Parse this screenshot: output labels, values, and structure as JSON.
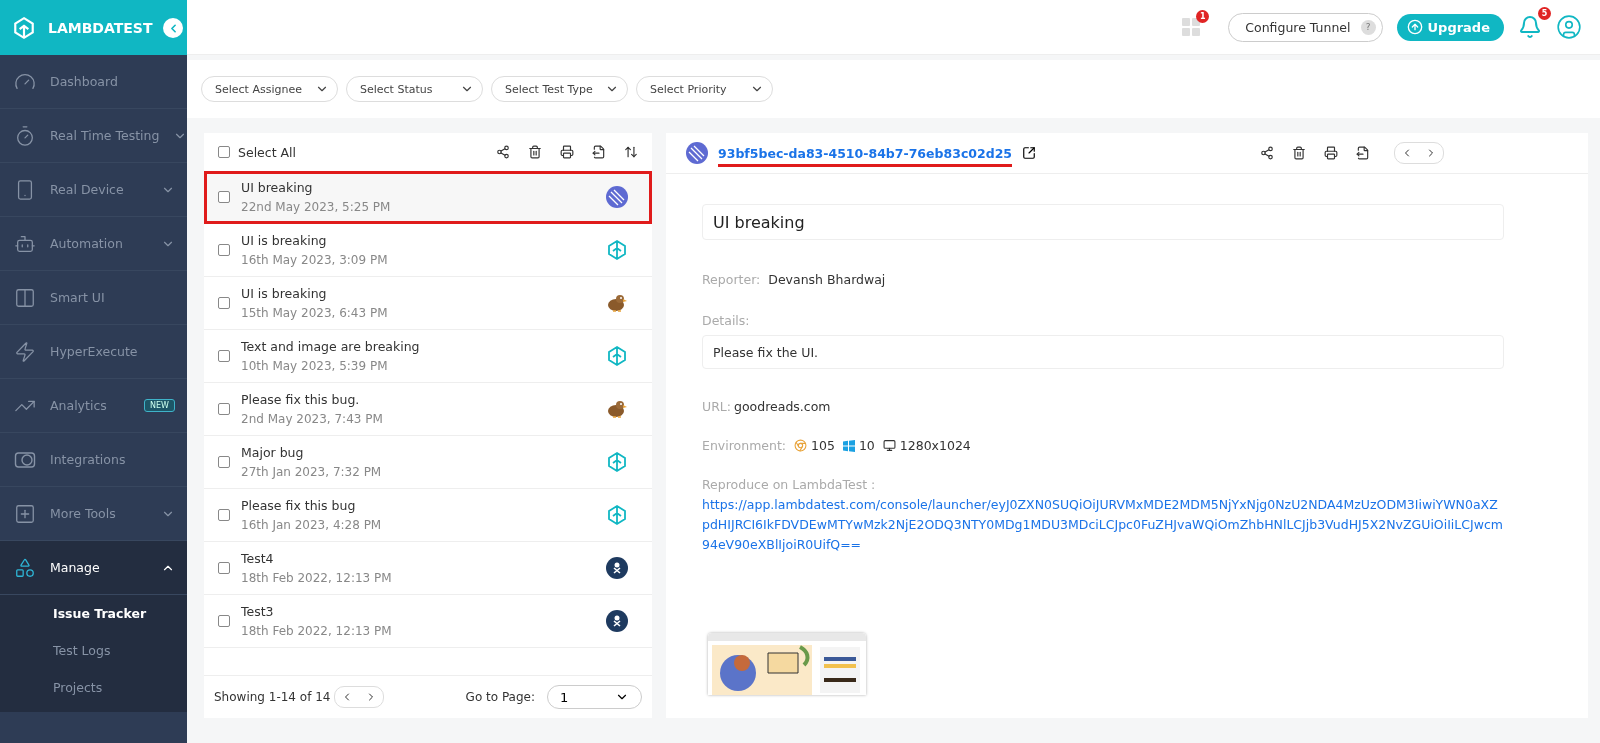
{
  "header": {
    "brand": "LAMBDATEST",
    "apps_badge": "1",
    "configure_tunnel": "Configure Tunnel",
    "help": "?",
    "upgrade": "Upgrade",
    "notifications_badge": "5"
  },
  "sidebar": {
    "items": [
      {
        "label": "Dashboard",
        "kind": "gauge"
      },
      {
        "label": "Real Time Testing",
        "kind": "timer",
        "expanded": false
      },
      {
        "label": "Real Device",
        "kind": "device",
        "expanded": false
      },
      {
        "label": "Automation",
        "kind": "robot",
        "expanded": false
      },
      {
        "label": "Smart UI",
        "kind": "split"
      },
      {
        "label": "HyperExecute",
        "kind": "bolt"
      },
      {
        "label": "Analytics",
        "kind": "chart",
        "badge": "NEW"
      },
      {
        "label": "Integrations",
        "kind": "integrations"
      },
      {
        "label": "More Tools",
        "kind": "plus",
        "expanded": false
      },
      {
        "label": "Manage",
        "kind": "shapes",
        "expanded": true,
        "children": [
          {
            "label": "Issue Tracker",
            "selected": true
          },
          {
            "label": "Test Logs",
            "selected": false
          },
          {
            "label": "Projects",
            "selected": false
          }
        ]
      }
    ]
  },
  "filters": [
    "Select Assignee",
    "Select Status",
    "Select Test Type",
    "Select Priority"
  ],
  "issue_list": {
    "select_all": {
      "label": "Select All",
      "checked": false
    },
    "rows": [
      {
        "title": "UI breaking",
        "date": "22nd May 2023, 5:25 PM",
        "checked": false,
        "selected": true,
        "kind": "stripes"
      },
      {
        "title": "UI is breaking",
        "date": "16th May 2023, 3:09 PM",
        "checked": false,
        "selected": false,
        "kind": "logo"
      },
      {
        "title": "UI is breaking",
        "date": "15th May 2023, 6:43 PM",
        "checked": false,
        "selected": false,
        "kind": "bird"
      },
      {
        "title": "Text and image are breaking",
        "date": "10th May 2023, 5:39 PM",
        "checked": false,
        "selected": false,
        "kind": "logo"
      },
      {
        "title": "Please fix this bug.",
        "date": "2nd May 2023, 7:43 PM",
        "checked": false,
        "selected": false,
        "kind": "bird"
      },
      {
        "title": "Major bug",
        "date": "27th Jan 2023, 7:32 PM",
        "checked": false,
        "selected": false,
        "kind": "logo"
      },
      {
        "title": "Please fix this bug",
        "date": "16th Jan 2023, 4:28 PM",
        "checked": false,
        "selected": false,
        "kind": "logo"
      },
      {
        "title": "Test4",
        "date": "18th Feb 2022, 12:13 PM",
        "checked": false,
        "selected": false,
        "kind": "badge"
      },
      {
        "title": "Test3",
        "date": "18th Feb 2022, 12:13 PM",
        "checked": false,
        "selected": false,
        "kind": "badge"
      }
    ],
    "showing": "Showing 1-14 of 14",
    "go_to_page": "Go to Page:",
    "page": "1"
  },
  "detail": {
    "issue_id": "93bf5bec-da83-4510-84b7-76eb83c02d25",
    "kind": "stripes",
    "title": "UI breaking",
    "reporter_label": "Reporter:",
    "reporter": "Devansh Bhardwaj",
    "details_label": "Details:",
    "details": "Please fix the UI.",
    "url_label": "URL:",
    "url": "goodreads.com",
    "environment_label": "Environment:",
    "browser_version": "105",
    "os_version": "10",
    "resolution": "1280x1024",
    "reproduce_label": "Reproduce on LambdaTest :",
    "reproduce_link": "https://app.lambdatest.com/console/launcher/eyJ0ZXN0SUQiOiJURVMxMDE2MDM5NjYxNjg0NzU2NDA4MzUzODM3IiwiYWN0aXZpdHIJRCI6IkFDVDEwMTYwMzk2NjE2ODQ3NTY0MDg1MDU3MDciLCJpc0FuZHJvaWQiOmZhbHNlLCJjb3VudHJ5X2NvZGUiOiIiLCJwcm94eV90eXBlIjoiR0UifQ=="
  }
}
